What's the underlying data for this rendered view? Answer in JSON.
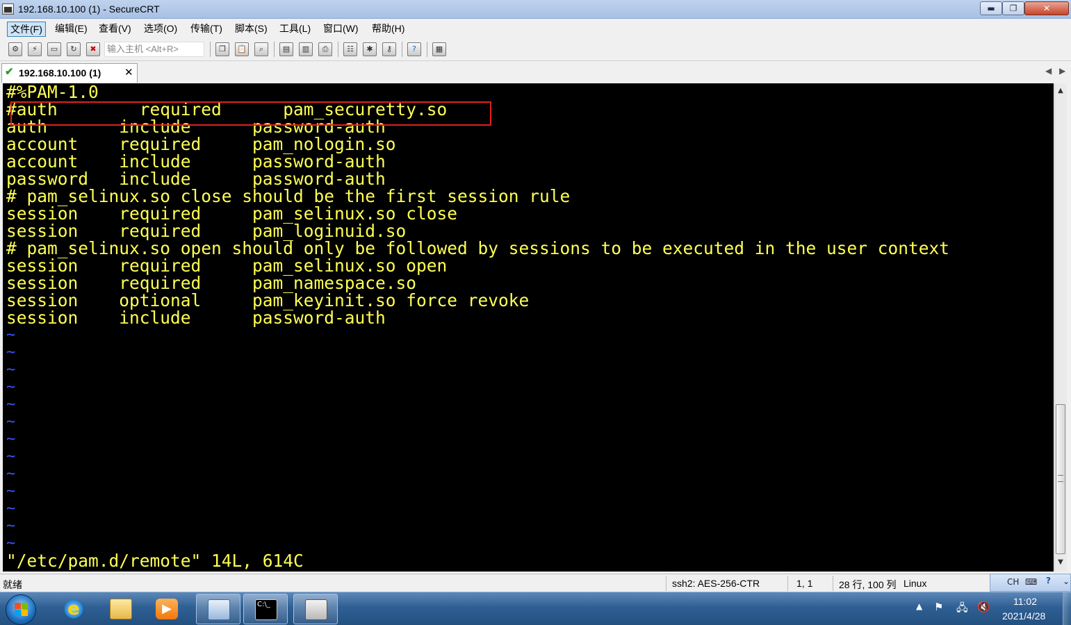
{
  "window": {
    "title": "192.168.10.100 (1) - SecureCRT",
    "minimize_label": "▬",
    "maximize_label": "❐",
    "close_label": "✕"
  },
  "menu": [
    {
      "label": "文件(F)"
    },
    {
      "label": "编辑(E)"
    },
    {
      "label": "查看(V)"
    },
    {
      "label": "选项(O)"
    },
    {
      "label": "传输(T)"
    },
    {
      "label": "脚本(S)"
    },
    {
      "label": "工具(L)"
    },
    {
      "label": "窗口(W)"
    },
    {
      "label": "帮助(H)"
    }
  ],
  "toolbar": {
    "quick_connect_placeholder": "输入主机 <Alt+R>",
    "buttons": [
      "connect-icon",
      "quick-connect-icon",
      "connect-tab-icon",
      "reconnect-icon",
      "disconnect-icon",
      "copy-icon",
      "paste-icon",
      "find-icon",
      "print-setup-icon",
      "print-selection-icon",
      "print-icon",
      "session-options-icon",
      "global-options-icon",
      "keymap-icon",
      "help-icon",
      "sftp-icon"
    ]
  },
  "tab": {
    "label": "192.168.10.100 (1)",
    "status_icon": "check-icon",
    "close_label": "✕"
  },
  "terminal": {
    "lines": [
      "#%PAM-1.0",
      "#auth        required      pam_securetty.so",
      "auth       include      password-auth",
      "account    required     pam_nologin.so",
      "account    include      password-auth",
      "password   include      password-auth",
      "# pam_selinux.so close should be the first session rule",
      "session    required     pam_selinux.so close",
      "session    required     pam_loginuid.so",
      "# pam_selinux.so open should only be followed by sessions to be executed in the user context",
      "session    required     pam_selinux.so open",
      "session    required     pam_namespace.so",
      "session    optional     pam_keyinit.so force revoke",
      "session    include      password-auth"
    ],
    "tilde": "~",
    "tilde_count": 13,
    "status_line": "\"/etc/pam.d/remote\" 14L, 614C",
    "text_color": "#ffff55",
    "tilde_color": "#3a55ff",
    "highlight_color": "#e02020"
  },
  "statusbar": {
    "ready": "就绪",
    "cipher": "ssh2: AES-256-CTR",
    "cursor": "1,  1",
    "size": "28 行, 100 列",
    "os": "Linux",
    "ime": "CH"
  },
  "taskbar": {
    "apps": [
      "start-button",
      "ie-icon",
      "explorer-icon",
      "media-player-icon",
      "server-manager-icon",
      "cmd-icon",
      "securecrt-icon"
    ],
    "time": "11:02",
    "date": "2021/4/28"
  }
}
